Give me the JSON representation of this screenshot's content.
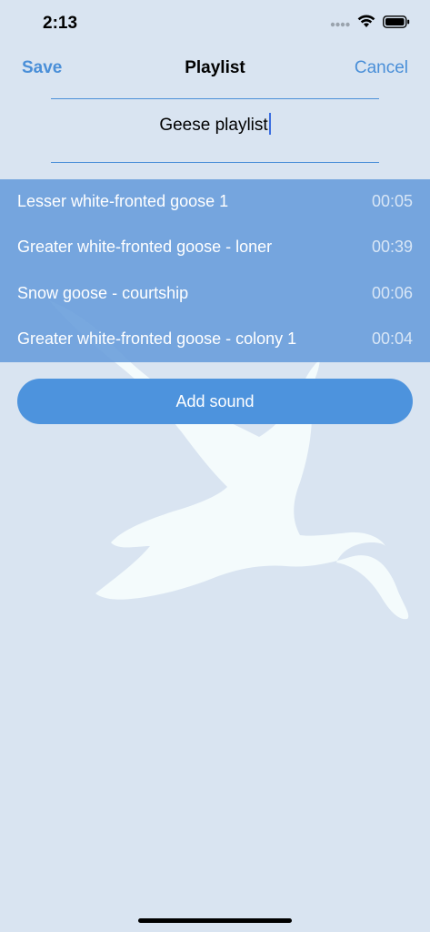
{
  "status_bar": {
    "time": "2:13"
  },
  "nav": {
    "save_label": "Save",
    "title": "Playlist",
    "cancel_label": "Cancel"
  },
  "playlist": {
    "name": "Geese playlist"
  },
  "sounds": [
    {
      "title": "Lesser white-fronted goose 1",
      "duration": "00:05"
    },
    {
      "title": "Greater white-fronted goose - loner",
      "duration": "00:39"
    },
    {
      "title": "Snow goose - courtship",
      "duration": "00:06"
    },
    {
      "title": "Greater white-fronted goose - colony 1",
      "duration": "00:04"
    }
  ],
  "add_sound_label": "Add sound",
  "colors": {
    "background": "#d9e4f1",
    "accent": "#4a8fd8",
    "list_bg": "#6a9fdc",
    "button": "#4d93dd"
  }
}
